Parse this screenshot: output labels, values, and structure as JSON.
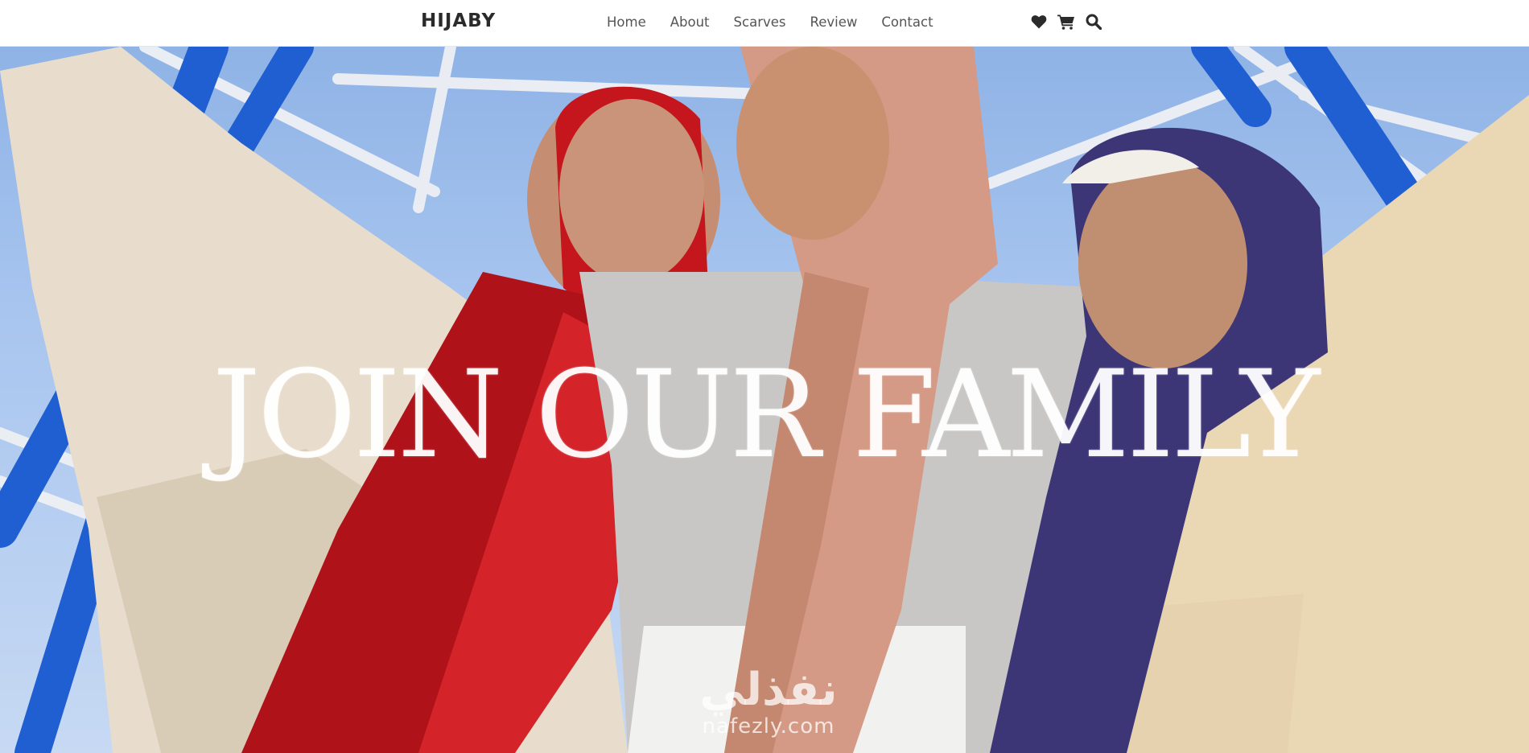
{
  "navbar": {
    "brand": "HIJABY",
    "links": [
      {
        "label": "Home"
      },
      {
        "label": "About"
      },
      {
        "label": "Scarves"
      },
      {
        "label": "Review"
      },
      {
        "label": "Contact"
      }
    ],
    "icons": [
      "heart-icon",
      "cart-icon",
      "search-icon"
    ]
  },
  "hero": {
    "title": "JOIN OUR FAMILY",
    "watermark_arabic": "نفذلي",
    "watermark_latin": "nafezly.com"
  },
  "colors": {
    "brand_text": "#2b2b2b",
    "nav_text": "#555555",
    "hero_title": "#ffffff",
    "scarf_red": "#c4161c",
    "scarf_pink": "#d49a86",
    "scarf_navy": "#3c3677",
    "steel_blue": "#1f5fd1"
  }
}
